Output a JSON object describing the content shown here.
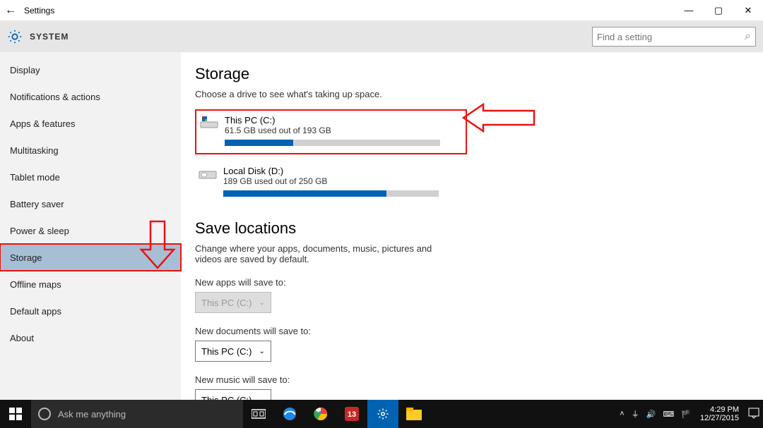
{
  "window": {
    "title": "Settings",
    "min": "—",
    "max": "▢",
    "close": "✕",
    "back": "←"
  },
  "header": {
    "breadcrumb": "SYSTEM",
    "search_placeholder": "Find a setting",
    "search_icon": "⌕"
  },
  "sidebar": {
    "items": [
      {
        "label": "Display"
      },
      {
        "label": "Notifications & actions"
      },
      {
        "label": "Apps & features"
      },
      {
        "label": "Multitasking"
      },
      {
        "label": "Tablet mode"
      },
      {
        "label": "Battery saver"
      },
      {
        "label": "Power & sleep"
      },
      {
        "label": "Storage",
        "selected": true
      },
      {
        "label": "Offline maps"
      },
      {
        "label": "Default apps"
      },
      {
        "label": "About"
      }
    ]
  },
  "storage": {
    "heading": "Storage",
    "subheading": "Choose a drive to see what's taking up space.",
    "drives": [
      {
        "name": "This PC (C:)",
        "detail": "61.5 GB used out of 193 GB",
        "pct": 31.9,
        "highlight": true,
        "system": true
      },
      {
        "name": "Local Disk (D:)",
        "detail": "189 GB used out of 250 GB",
        "pct": 75.6,
        "highlight": false,
        "system": false
      }
    ]
  },
  "save": {
    "heading": "Save locations",
    "subheading": "Change where your apps, documents, music, pictures and videos are saved by default.",
    "rows": [
      {
        "label": "New apps will save to:",
        "value": "This PC (C:)",
        "disabled": true
      },
      {
        "label": "New documents will save to:",
        "value": "This PC (C:)",
        "disabled": false
      },
      {
        "label": "New music will save to:",
        "value": "This PC (C:)",
        "disabled": false
      }
    ],
    "chev": "⌄"
  },
  "taskbar": {
    "cortana": "Ask me anything",
    "tray_up": "˄",
    "tray_net": "⏚",
    "tray_vol": "🔊",
    "tray_key": "⌨",
    "time": "4:29 PM",
    "date": "12/27/2015"
  }
}
